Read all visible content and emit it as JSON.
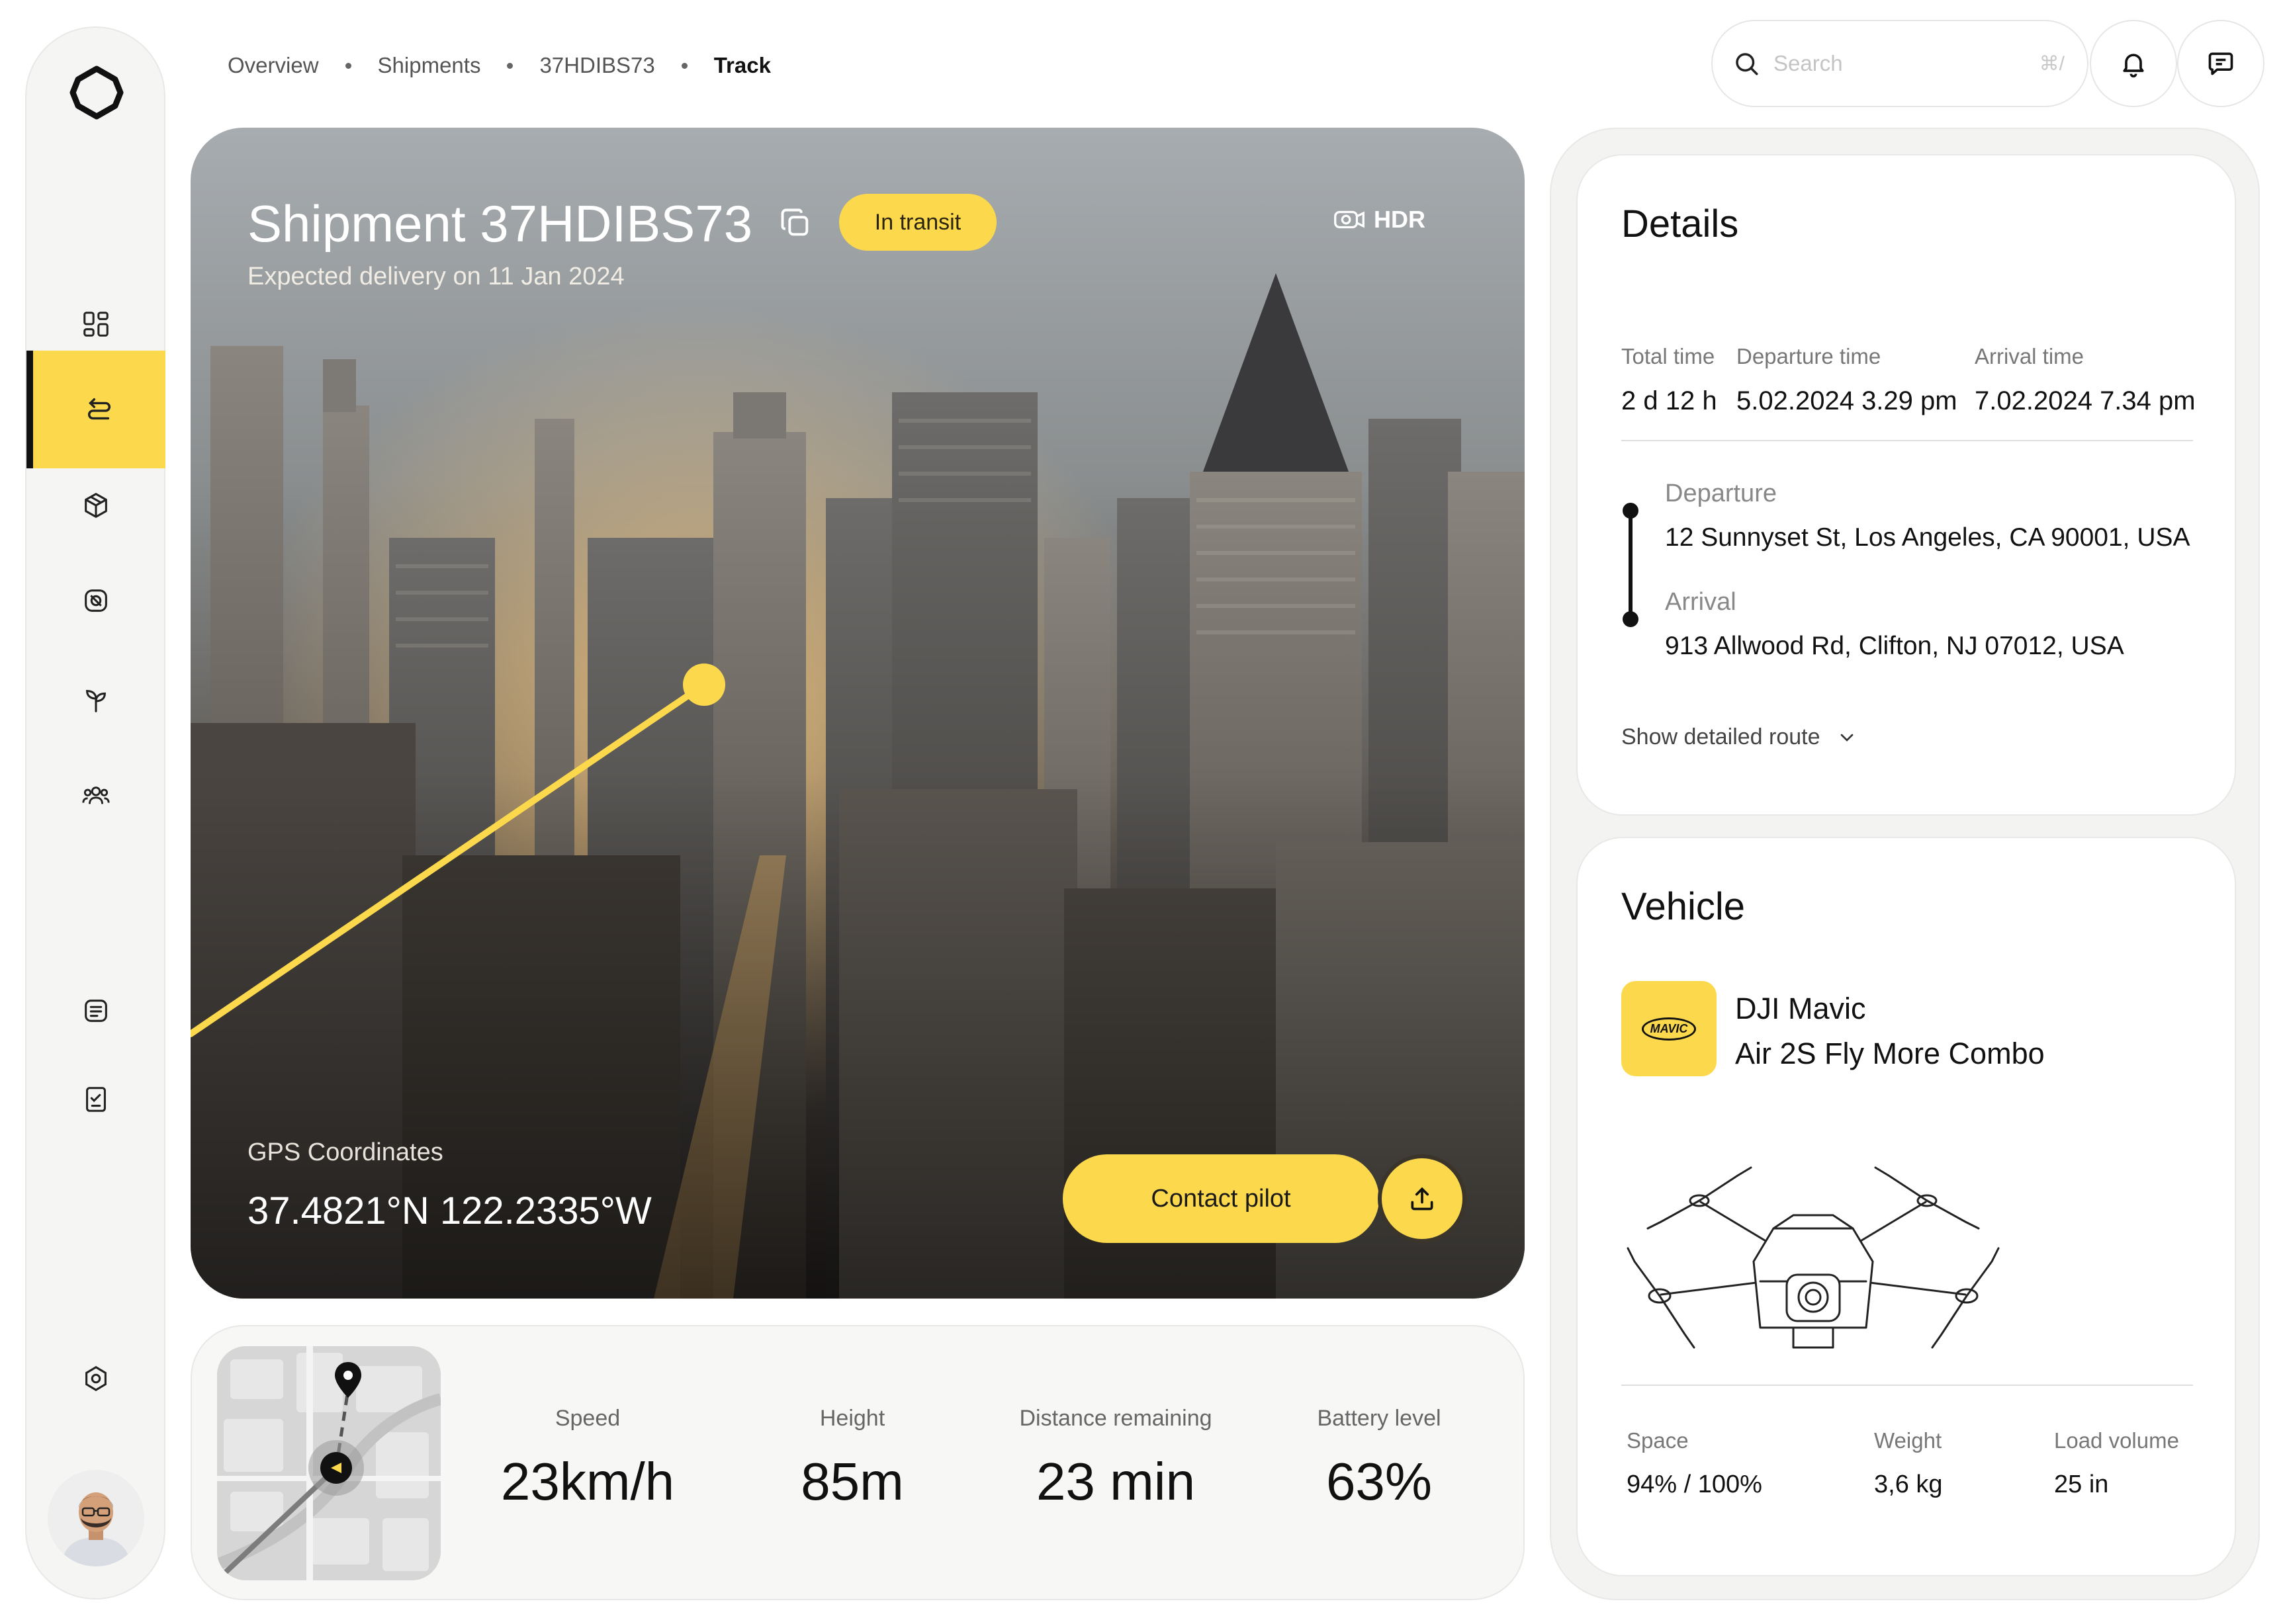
{
  "breadcrumb": [
    "Overview",
    "Shipments",
    "37HDIBS73",
    "Track"
  ],
  "search": {
    "placeholder": "Search",
    "shortcut": "⌘/"
  },
  "sidebar": {
    "items": [
      {
        "icon": "dashboard-icon"
      },
      {
        "icon": "route-icon",
        "active": true
      },
      {
        "icon": "package-icon"
      },
      {
        "icon": "tag-icon"
      },
      {
        "icon": "sprout-icon"
      },
      {
        "icon": "team-icon"
      },
      {
        "icon": "list-icon"
      },
      {
        "icon": "checklist-icon"
      },
      {
        "icon": "settings-icon"
      }
    ]
  },
  "hero": {
    "title": "Shipment 37HDIBS73",
    "status": "In transit",
    "hdr": "HDR",
    "subtitle": "Expected delivery on 11 Jan 2024",
    "gps_label": "GPS Coordinates",
    "gps_value": "37.4821°N 122.2335°W",
    "contact_label": "Contact pilot"
  },
  "stats": [
    {
      "label": "Speed",
      "value": "23km/h"
    },
    {
      "label": "Height",
      "value": "85m"
    },
    {
      "label": "Distance remaining",
      "value": "23 min"
    },
    {
      "label": "Battery level",
      "value": "63%"
    }
  ],
  "details": {
    "title": "Details",
    "total_time_label": "Total time",
    "total_time": "2 d 12 h",
    "departure_time_label": "Departure time",
    "departure_time": "5.02.2024 3.29 pm",
    "arrival_time_label": "Arrival time",
    "arrival_time": "7.02.2024 7.34 pm",
    "departure_label": "Departure",
    "departure_address": "12 Sunnyset St, Los Angeles, CA 90001, USA",
    "arrival_label": "Arrival",
    "arrival_address": "913 Allwood Rd, Clifton, NJ 07012, USA",
    "show_route": "Show detailed route"
  },
  "vehicle": {
    "title": "Vehicle",
    "logo_text": "MAVIC",
    "name_line1": "DJI Mavic",
    "name_line2": "Air 2S Fly More Combo",
    "space_label": "Space",
    "space": "94% / 100%",
    "weight_label": "Weight",
    "weight": "3,6 kg",
    "load_label": "Load volume",
    "load": "25 in"
  },
  "colors": {
    "accent": "#fcd94c",
    "text": "#111111"
  }
}
